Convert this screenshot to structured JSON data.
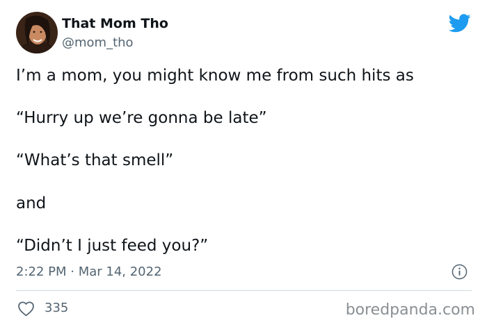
{
  "tweet": {
    "author": {
      "display_name": "That Mom Tho",
      "handle": "@mom_tho"
    },
    "lines": [
      "I’m a mom, you might know me from such hits as",
      "“Hurry up we’re gonna be late”",
      "“What’s that smell”",
      "and",
      "“Didn’t I just feed you?”"
    ],
    "timestamp": "2:22 PM · Mar 14, 2022",
    "likes": "335"
  },
  "icons": {
    "brand": "twitter-bird-icon",
    "info": "info-icon",
    "like": "heart-icon"
  },
  "watermark": "boredpanda.com",
  "colors": {
    "twitter_blue": "#1d9bf0",
    "text_primary": "#0f1419",
    "text_secondary": "#536471",
    "divider": "#cfd9de"
  }
}
